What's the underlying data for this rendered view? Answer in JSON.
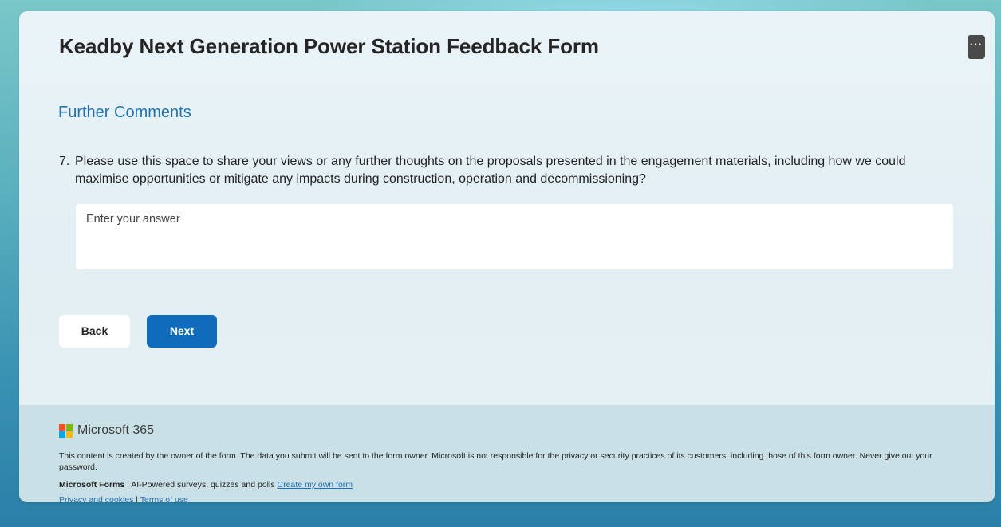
{
  "form": {
    "title": "Keadby Next Generation Power Station Feedback Form",
    "more_label": "···",
    "section_title": "Further Comments",
    "question": {
      "number": "7.",
      "text": "Please use this space to share your views or any further thoughts on the proposals presented in the engagement materials, including how we could maximise opportunities or mitigate any impacts during construction, operation and decommissioning?",
      "answer_value": "",
      "answer_placeholder": "Enter your answer"
    },
    "buttons": {
      "back_label": "Back",
      "next_label": "Next"
    }
  },
  "footer": {
    "brand": "Microsoft 365",
    "disclaimer": "This content is created by the owner of the form. The data you submit will be sent to the form owner. Microsoft is not responsible for the privacy or security practices of its customers, including those of this form owner. Never give out your password.",
    "forms_name": "Microsoft Forms",
    "forms_tagline": " | AI-Powered surveys, quizzes and polls ",
    "create_link": "Create my own form",
    "privacy_link": "Privacy and cookies",
    "separator": " | ",
    "terms_link": "Terms of use"
  },
  "colors": {
    "accent": "#0f6cbd",
    "section_title": "#1f73b5",
    "link": "#1f6fb4"
  },
  "icons": {
    "more": "more-options-icon",
    "brand": "microsoft-logo-icon"
  }
}
